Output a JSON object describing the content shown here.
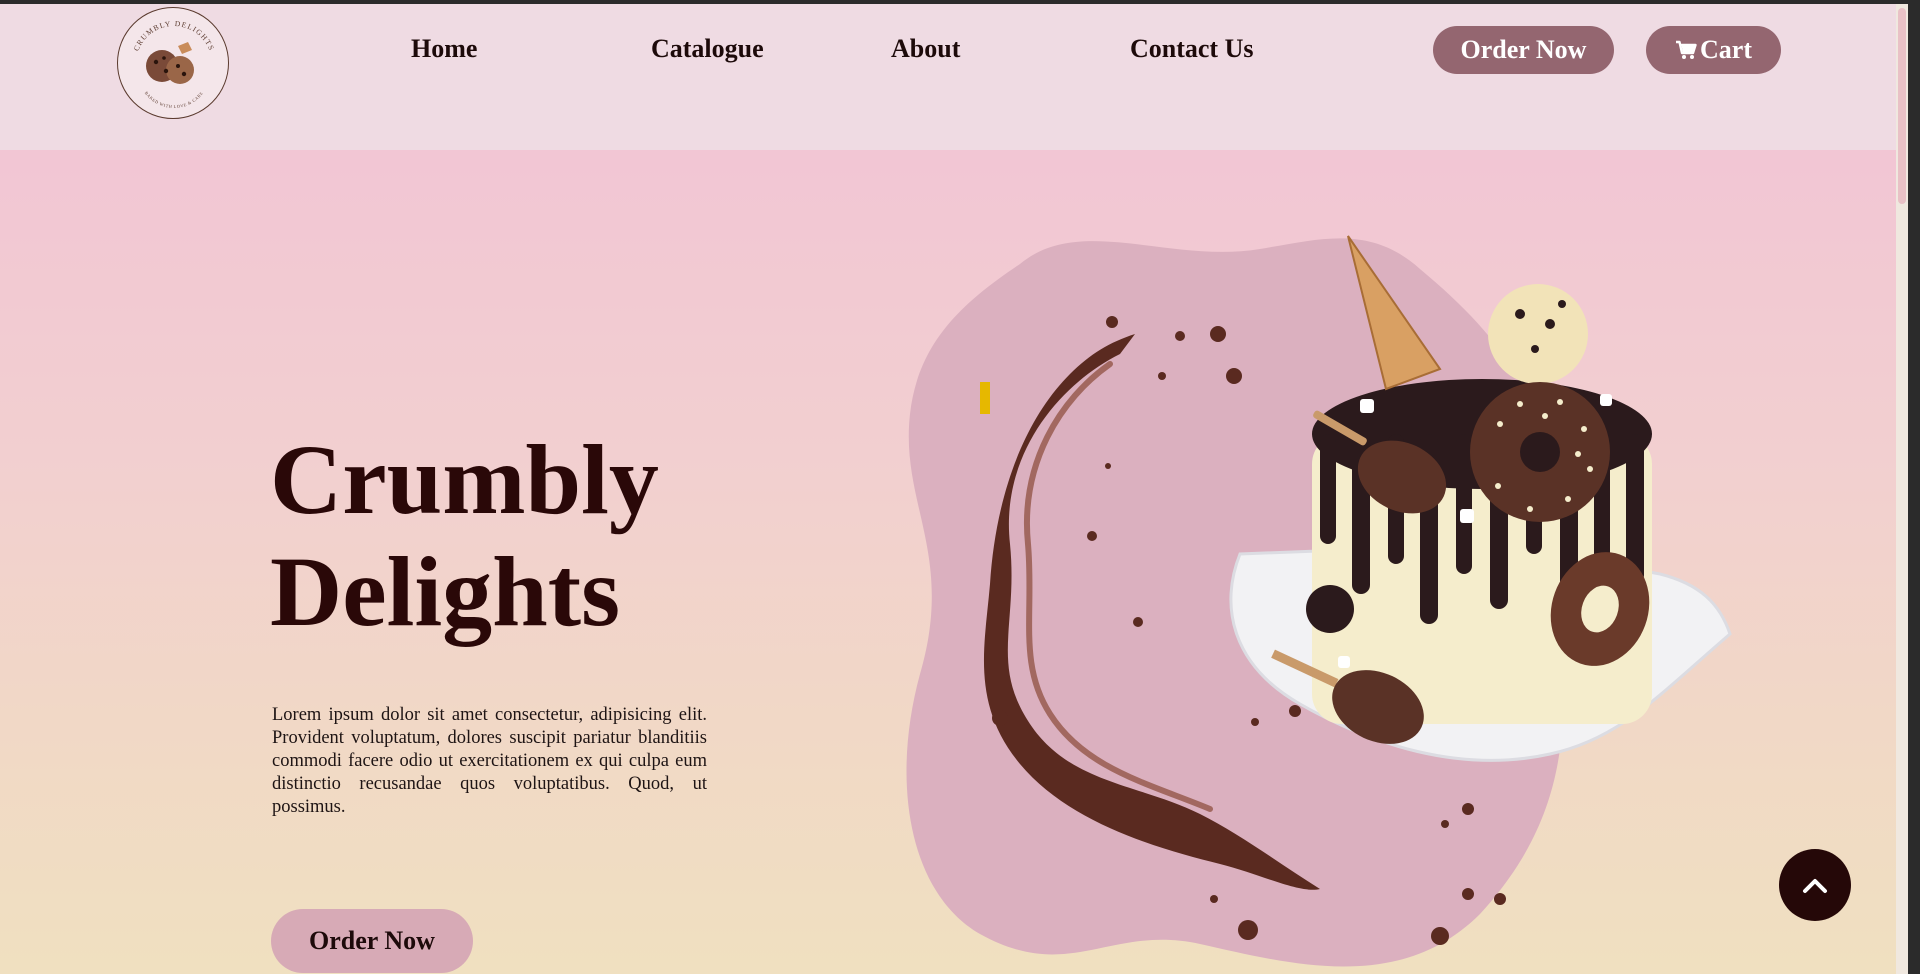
{
  "brand": {
    "name": "Crumbly Delights",
    "logo_top_text": "CRUMBLY DELIGHTS",
    "logo_bottom_text": "BAKED WITH LOVE & CARE"
  },
  "nav": {
    "items": [
      {
        "label": "Home"
      },
      {
        "label": "Catalogue"
      },
      {
        "label": "About"
      },
      {
        "label": "Contact Us"
      }
    ],
    "order_button": "Order Now",
    "cart_button": "Cart",
    "cart_icon": "cart-icon"
  },
  "hero": {
    "title_line1": "Crumbly",
    "title_line2": "Delights",
    "description": "Lorem ipsum dolor sit amet consectetur, adipisicing elit. Provident voluptatum, dolores suscipit pariatur blanditiis commodi facere odio ut exercitationem ex qui culpa eum distinctio recusandae quos voluptatibus. Quod, ut possimus.",
    "cta_button": "Order Now",
    "image_icon": "chocolate-cake-illustration"
  },
  "scroll_top": {
    "icon": "chevron-up-icon"
  },
  "colors": {
    "accent": "#946670",
    "header_bg": "#efdbe3",
    "title": "#2a0808",
    "blob": "#dbb0bf",
    "chocolate": "#5a2a20"
  }
}
